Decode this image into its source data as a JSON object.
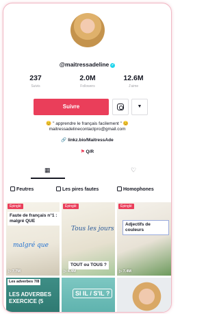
{
  "profile": {
    "username": "@maitressadeline",
    "verified_icon": "verified-check-icon",
    "stats": [
      {
        "value": "237",
        "label": "Suivis"
      },
      {
        "value": "2.0M",
        "label": "Followers"
      },
      {
        "value": "12.6M",
        "label": "J'aime"
      }
    ],
    "follow_label": "Suivre",
    "more_glyph": "▼",
    "bio_line1": "😊 \" apprendre le français facilement \" 😊",
    "bio_line2": "maitressadelinecontactpro@gmail.com",
    "link_icon": "🔗",
    "link": "linkz.bio/MaitressAde",
    "qa_label": "Q/R"
  },
  "tabs": {
    "videos_icon": "▦",
    "liked_icon": "♡"
  },
  "playlists": [
    "Feutres",
    "Les pires fautes",
    "Homophones"
  ],
  "videos": [
    {
      "badge": "Épinglé",
      "caption": "Faute de français n°1 : malgré QUE",
      "views": "7.7M",
      "overlay": "malgré que"
    },
    {
      "badge": "Épinglé",
      "caption": "TOUT ou TOUS ?",
      "views": "4.4M",
      "overlay": "Tous les jours"
    },
    {
      "badge": "Épinglé",
      "caption": "Adjectifs de couleurs",
      "views": "7.4M"
    },
    {
      "caption": "Les adverbes",
      "counter": "7/8",
      "overlay": "LES ADVERBES EXERCICE (5"
    },
    {
      "overlay": "SI IL / S'IL ?"
    },
    {}
  ],
  "colors": {
    "accent": "#ea3e5a",
    "border": "#f1b7c3",
    "verified": "#20d5ec"
  }
}
